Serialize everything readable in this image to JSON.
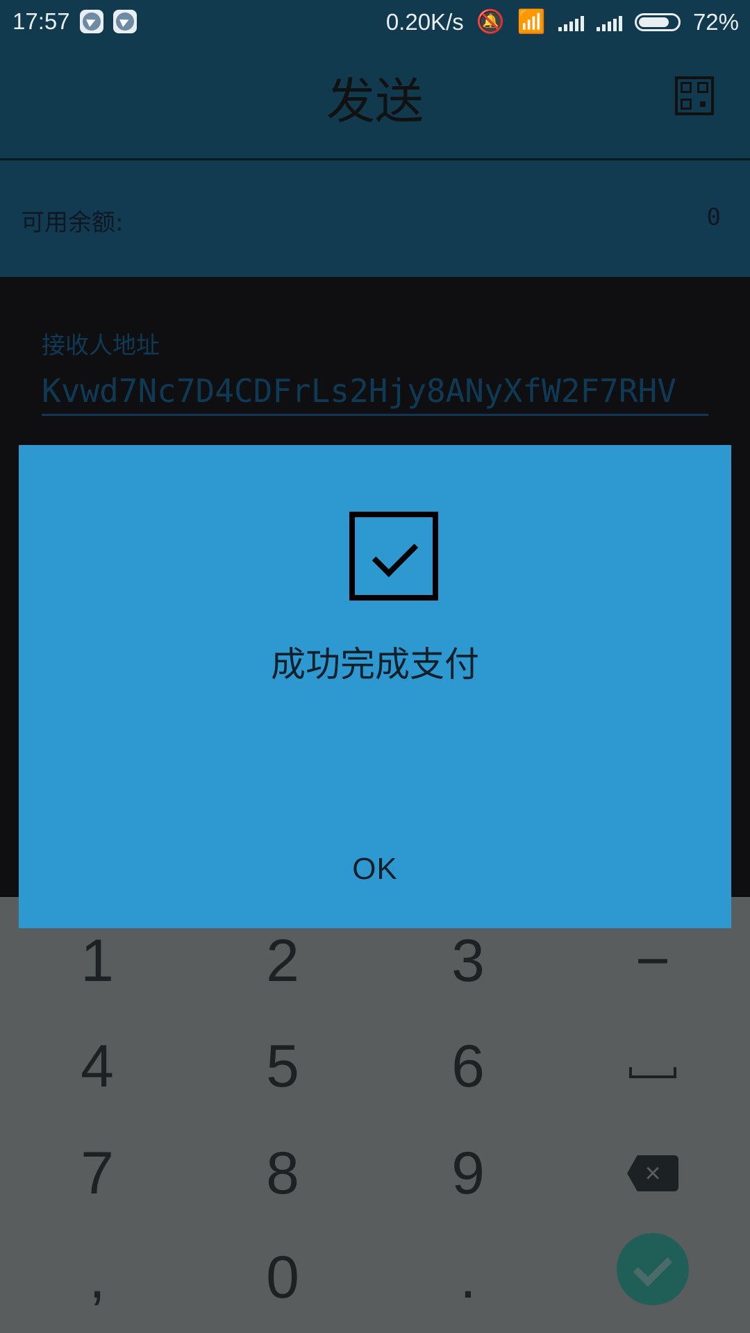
{
  "status_bar": {
    "time": "17:57",
    "network_speed": "0.20K/s",
    "battery_percent": "72%",
    "icons": [
      "telegram-icon",
      "telegram-icon",
      "mute-bell-icon",
      "wifi-icon",
      "signal-icon",
      "signal-icon",
      "battery-icon"
    ]
  },
  "header": {
    "title": "发送",
    "qr_icon": "qr-code-icon"
  },
  "balance": {
    "label": "可用余额:",
    "value": "0"
  },
  "recipient": {
    "label": "接收人地址",
    "address": "Kvwd7Nc7D4CDFrLs2Hjy8ANyXfW2F7RHV"
  },
  "dialog": {
    "icon": "checkbox-check-icon",
    "message": "成功完成支付",
    "ok_label": "OK"
  },
  "keyboard": {
    "keys": [
      "1",
      "2",
      "3",
      "−",
      "4",
      "5",
      "6",
      "␣",
      "7",
      "8",
      "9",
      "⌫",
      ",",
      "0",
      ".",
      "✓"
    ]
  },
  "colors": {
    "header_bg": "#113a4f",
    "dialog_bg": "#2e99d1",
    "keyboard_bg": "#5a5d5d",
    "accent": "#0f3a55"
  }
}
